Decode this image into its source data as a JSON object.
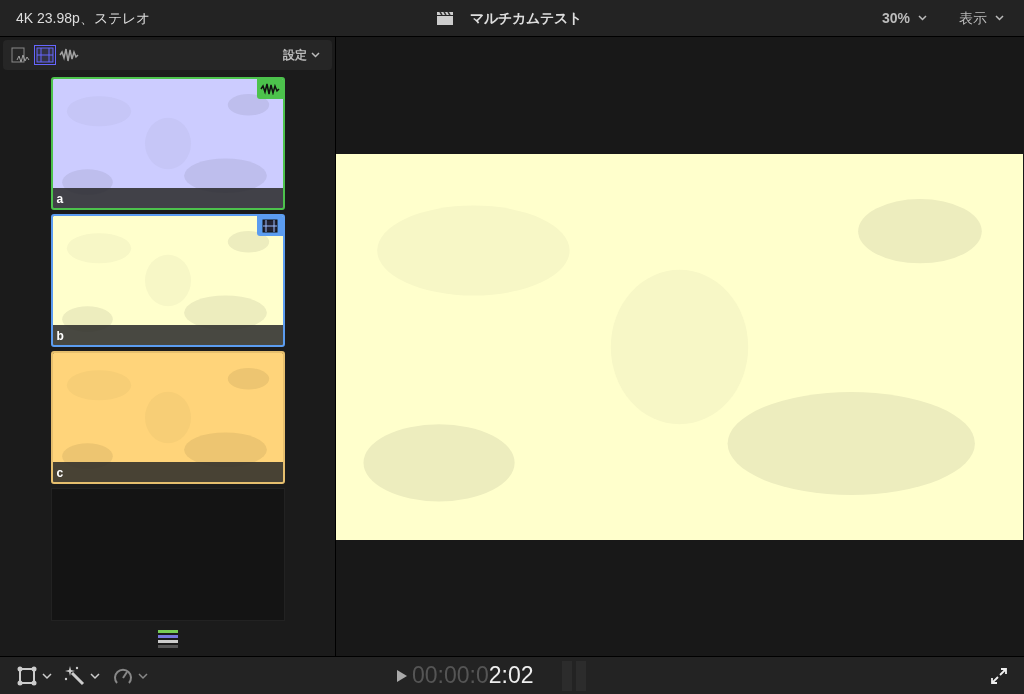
{
  "format": "4K 23.98p、ステレオ",
  "title": "マルチカムテスト",
  "zoom": "30%",
  "view_menu": "表示",
  "angle_toolbar": {
    "modes": [
      {
        "kind": "both",
        "selected": false
      },
      {
        "kind": "video",
        "selected": true
      },
      {
        "kind": "audio",
        "selected": false
      }
    ],
    "settings": "設定"
  },
  "angles": [
    {
      "label": "a",
      "color": "#ccccff",
      "audio": true,
      "video": false
    },
    {
      "label": "b",
      "color": "#ffffcc",
      "audio": false,
      "video": true
    },
    {
      "label": "c",
      "color": "#ffd47a",
      "audio": false,
      "video": false
    }
  ],
  "timecode": {
    "lead": "00:00:0",
    "value": "2:02"
  }
}
